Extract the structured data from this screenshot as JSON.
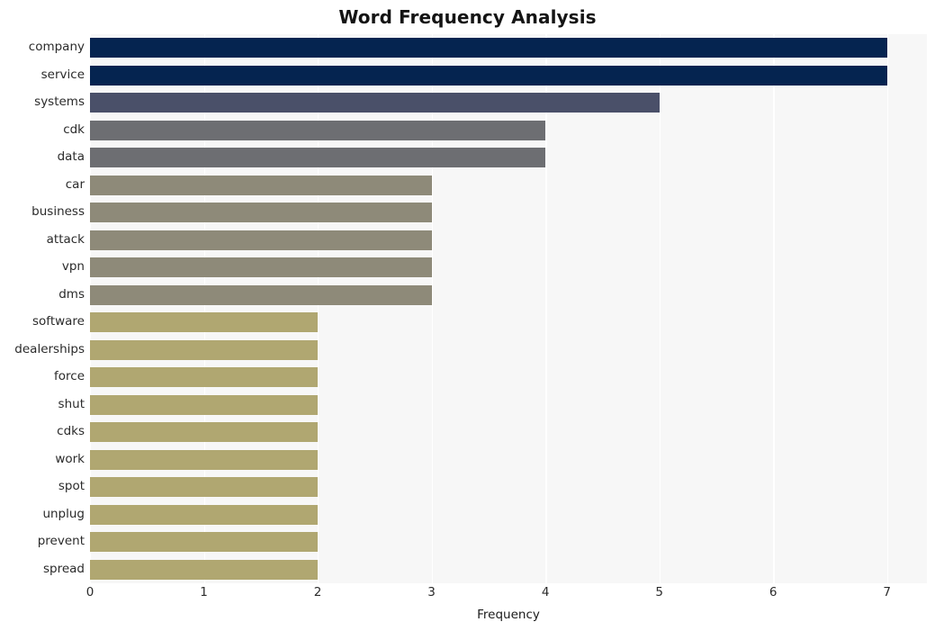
{
  "chart_data": {
    "type": "bar",
    "orientation": "horizontal",
    "title": "Word Frequency Analysis",
    "xlabel": "Frequency",
    "ylabel": "",
    "xlim": [
      0,
      7.35
    ],
    "xticks": [
      0,
      1,
      2,
      3,
      4,
      5,
      6,
      7
    ],
    "xtick_labels": [
      "0",
      "1",
      "2",
      "3",
      "4",
      "5",
      "6",
      "7"
    ],
    "grid": true,
    "grid_axis": "x",
    "legend": false,
    "categories": [
      "company",
      "service",
      "systems",
      "cdk",
      "data",
      "car",
      "business",
      "attack",
      "vpn",
      "dms",
      "software",
      "dealerships",
      "force",
      "shut",
      "cdks",
      "work",
      "spot",
      "unplug",
      "prevent",
      "spread"
    ],
    "values": [
      7,
      7,
      5,
      4,
      4,
      3,
      3,
      3,
      3,
      3,
      2,
      2,
      2,
      2,
      2,
      2,
      2,
      2,
      2,
      2
    ],
    "bar_colors": [
      "#052450",
      "#052450",
      "#4a5069",
      "#6d6e72",
      "#6d6e72",
      "#8e8a79",
      "#8e8a79",
      "#8e8a79",
      "#8e8a79",
      "#8e8a79",
      "#b0a771",
      "#b0a771",
      "#b0a771",
      "#b0a771",
      "#b0a771",
      "#b0a771",
      "#b0a771",
      "#b0a771",
      "#b0a771",
      "#b0a771"
    ],
    "plot_background": "#f7f7f7",
    "grid_color": "#ffffff",
    "title_color": "#141414",
    "tick_label_color": "#2b2b2b"
  }
}
